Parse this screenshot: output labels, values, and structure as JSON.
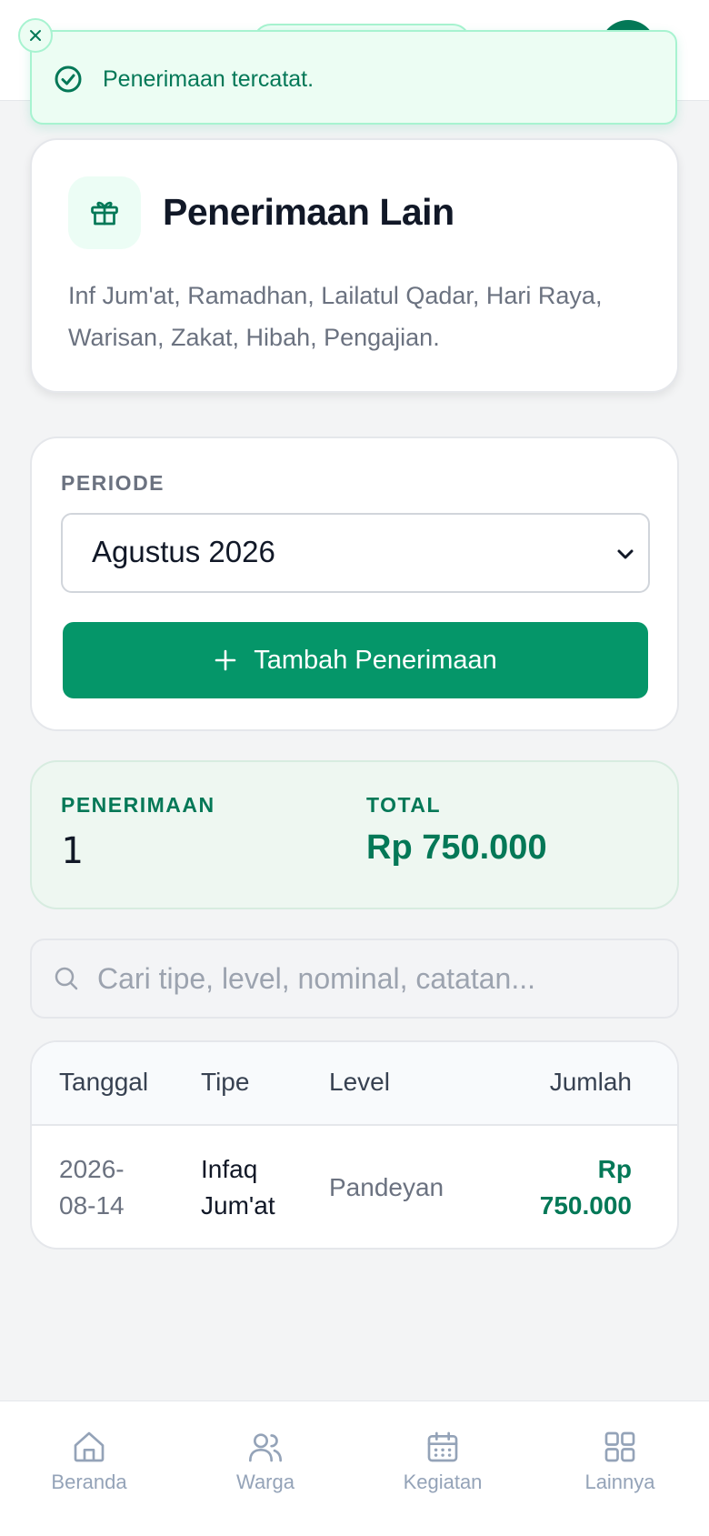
{
  "toast": {
    "message": "Penerimaan tercatat."
  },
  "header": {
    "title": "Penerimaan Lain",
    "description": "Inf Jum'at, Ramadhan, Lailatul Qadar, Hari Raya, Warisan, Zakat, Hibah, Pengajian."
  },
  "period": {
    "label": "PERIODE",
    "selected": "Agustus 2026",
    "add_button": "Tambah Penerimaan"
  },
  "stats": {
    "count_label": "PENERIMAAN",
    "count_value": "1",
    "total_label": "TOTAL",
    "total_value": "Rp 750.000"
  },
  "search": {
    "placeholder": "Cari tipe, level, nominal, catatan..."
  },
  "table": {
    "headers": [
      "Tanggal",
      "Tipe",
      "Level",
      "Jumlah"
    ],
    "rows": [
      {
        "tanggal_1": "2026-",
        "tanggal_2": "08-14",
        "tipe_1": "Infaq",
        "tipe_2": "Jum'at",
        "level": "Pandeyan",
        "jumlah_1": "Rp",
        "jumlah_2": "750.000"
      }
    ]
  },
  "nav": [
    {
      "label": "Beranda",
      "icon": "home-icon"
    },
    {
      "label": "Warga",
      "icon": "users-icon"
    },
    {
      "label": "Kegiatan",
      "icon": "calendar-icon"
    },
    {
      "label": "Lainnya",
      "icon": "grid-icon"
    }
  ],
  "colors": {
    "accent": "#059669",
    "accent_dark": "#047857",
    "toast_bg": "#ecfdf3"
  }
}
